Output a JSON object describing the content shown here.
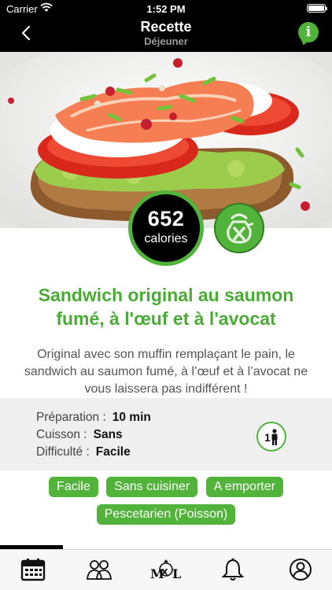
{
  "status_bar": {
    "carrier": "Carrier",
    "time": "1:52 PM"
  },
  "navbar": {
    "title": "Recette",
    "subtitle": "Déjeuner",
    "info_label": "i"
  },
  "calories": {
    "value": "652",
    "unit": "calories"
  },
  "recipe": {
    "title": "Sandwich original au saumon fumé, à l'œuf et à l'avocat",
    "description": "Original avec son muffin remplaçant le pain, le sandwich au saumon fumé, à l’œuf et à l’avocat ne vous laissera pas indifférent !"
  },
  "details": {
    "preparation_label": "Préparation :",
    "preparation_value": "10 min",
    "cuisson_label": "Cuisson :",
    "cuisson_value": "Sans",
    "difficulte_label": "Difficulté :",
    "difficulte_value": "Facile",
    "servings": "1"
  },
  "tags": [
    "Facile",
    "Sans cuisiner",
    "A emporter",
    "Pescetarien (Poisson)"
  ],
  "tabbar": {
    "items": [
      "calendar-icon",
      "community-icon",
      "mxl-logo",
      "bell-icon",
      "profile-icon"
    ],
    "logo_text": "MXL"
  },
  "colors": {
    "accent": "#51b33a",
    "title_green": "#4aac35",
    "bar": "#000000"
  }
}
